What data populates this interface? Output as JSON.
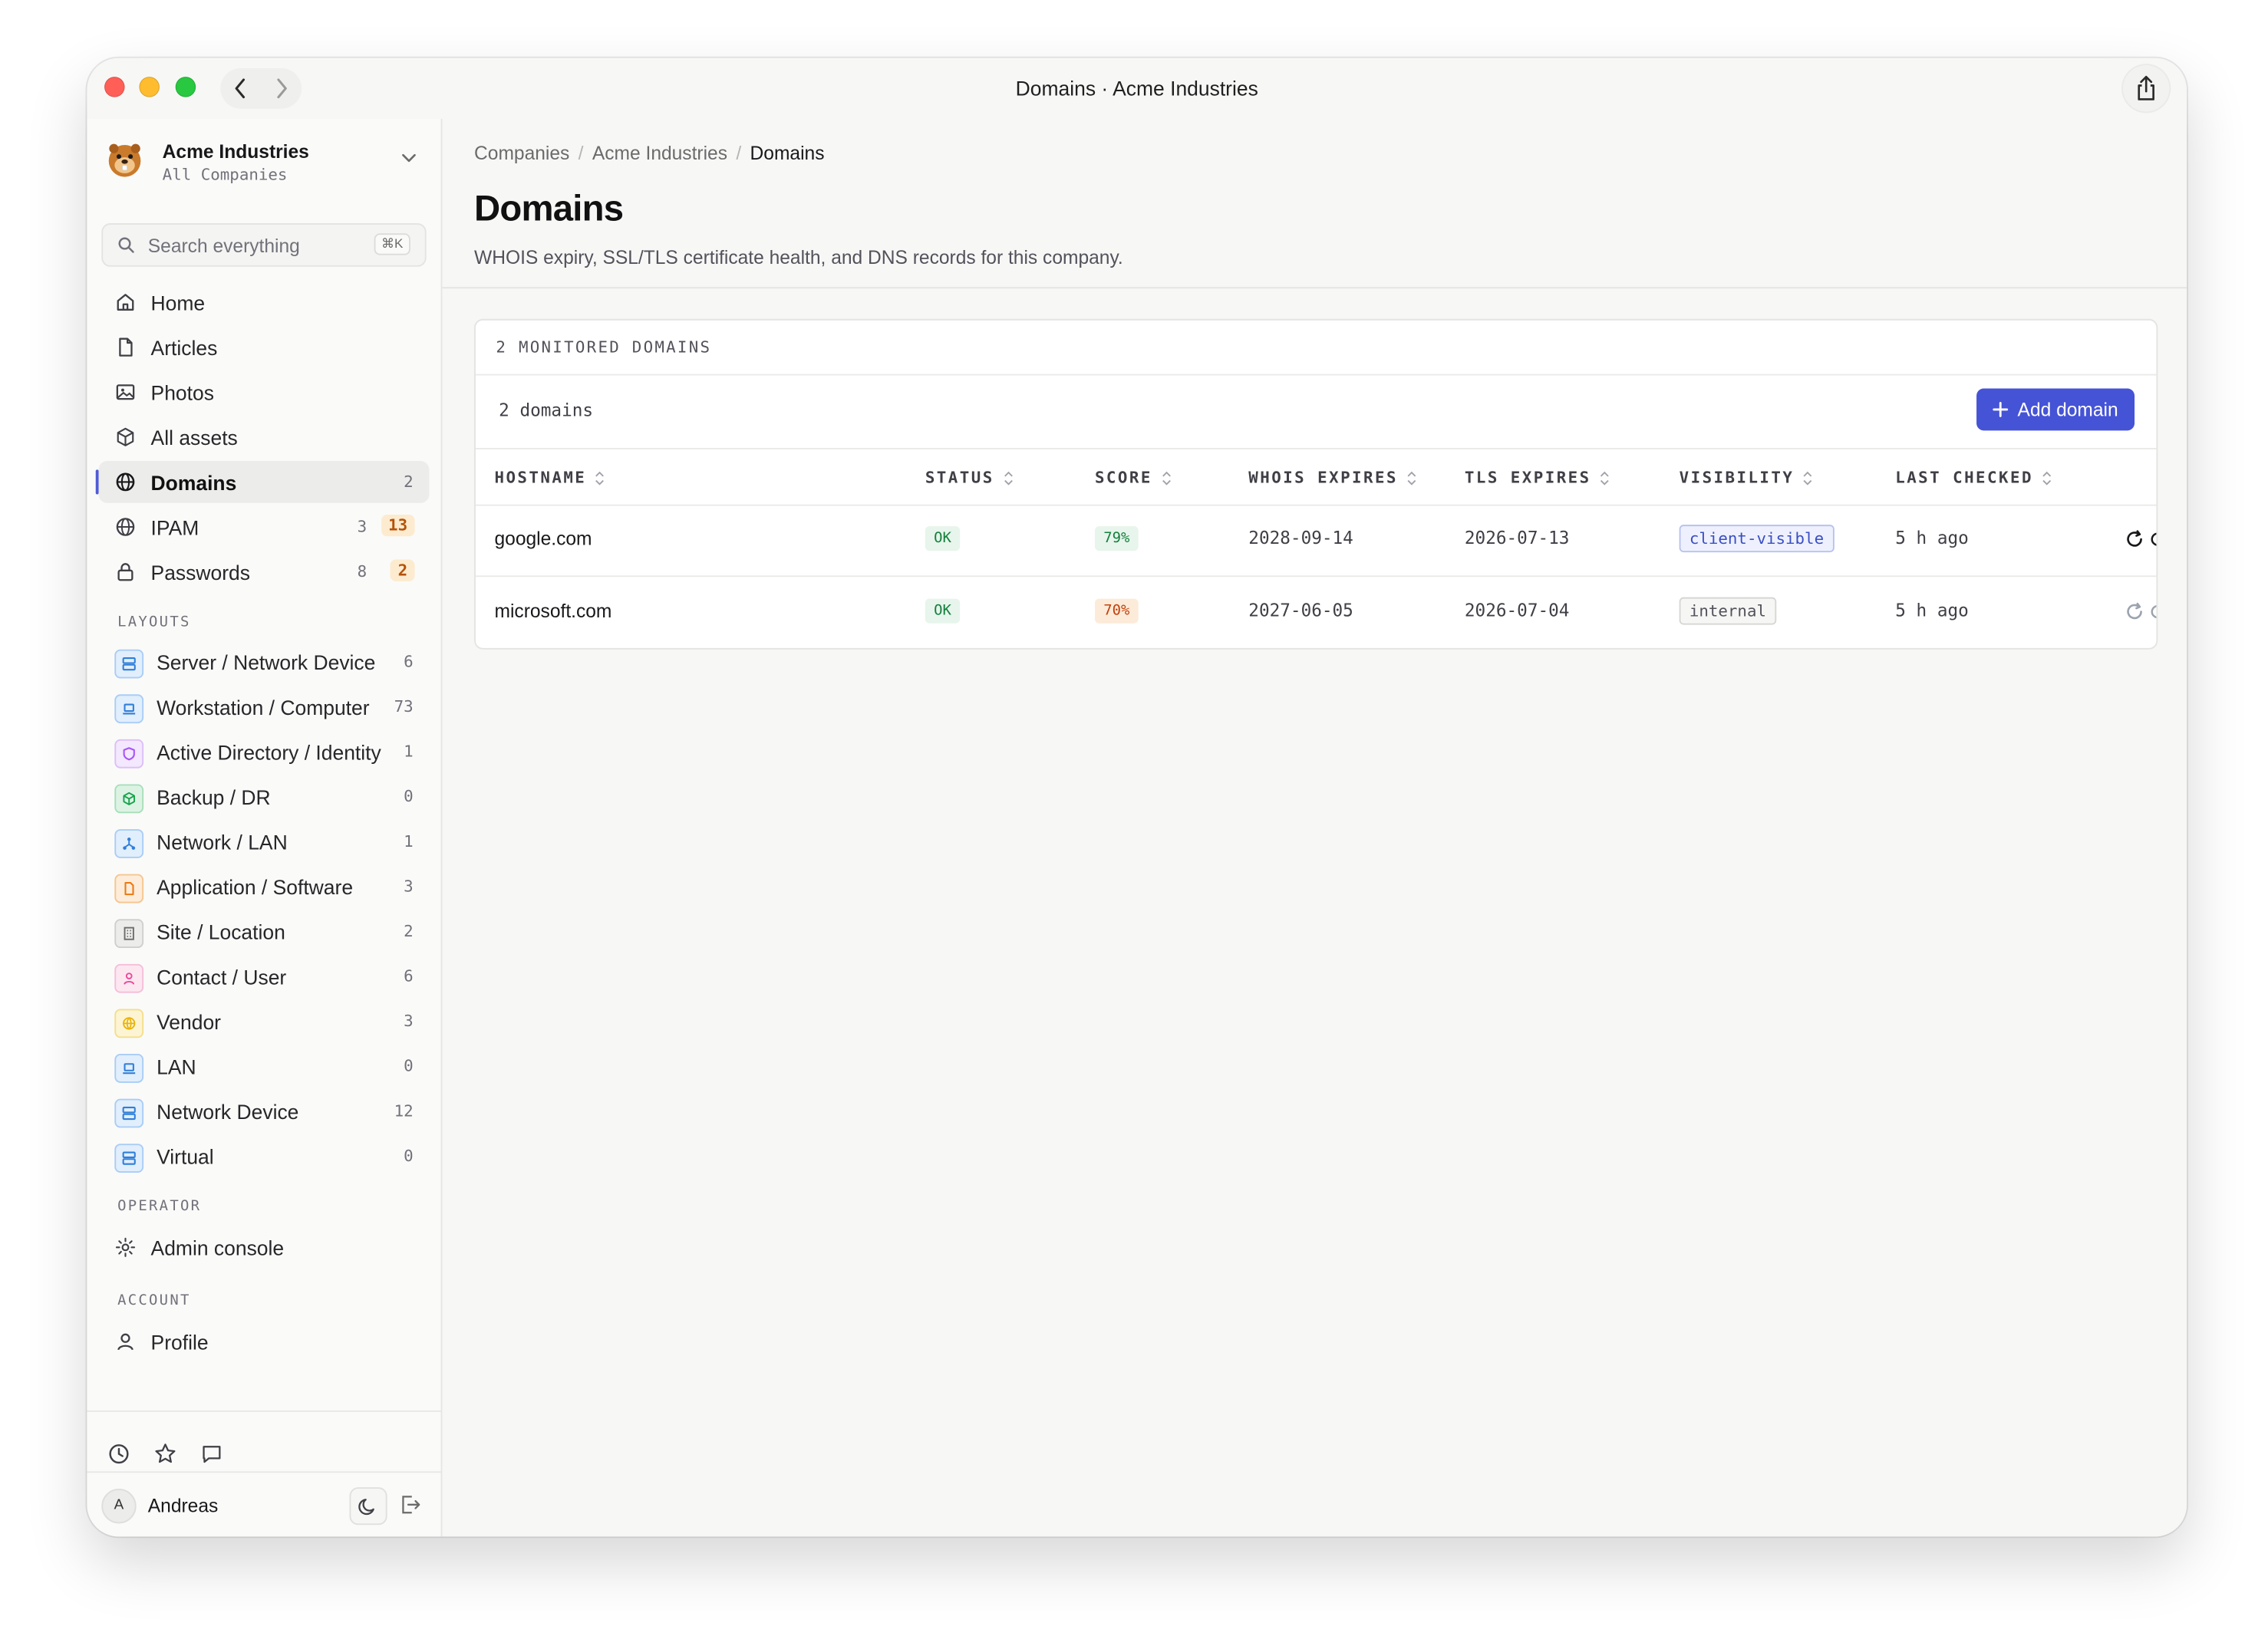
{
  "window": {
    "title": "Domains · Acme Industries"
  },
  "sidebar": {
    "company": {
      "name": "Acme Industries",
      "subtitle": "All Companies"
    },
    "search": {
      "placeholder": "Search everything",
      "shortcut": "⌘K"
    },
    "nav": [
      {
        "label": "Home",
        "icon": "home-icon"
      },
      {
        "label": "Articles",
        "icon": "file-icon"
      },
      {
        "label": "Photos",
        "icon": "image-icon"
      },
      {
        "label": "All assets",
        "icon": "box-icon"
      },
      {
        "label": "Domains",
        "icon": "globe-icon",
        "count": "2",
        "active": true
      },
      {
        "label": "IPAM",
        "icon": "globe-icon",
        "count": "3",
        "badge": "13"
      },
      {
        "label": "Passwords",
        "icon": "lock-icon",
        "count": "8",
        "badge": "2"
      }
    ],
    "layouts_label": "LAYOUTS",
    "layouts": [
      {
        "label": "Server / Network Device",
        "count": "6",
        "icon": "server-icon",
        "color": "#2f7fd8",
        "bg": "#e1eefc"
      },
      {
        "label": "Workstation / Computer",
        "count": "73",
        "icon": "laptop-icon",
        "color": "#2f7fd8",
        "bg": "#e1eefc"
      },
      {
        "label": "Active Directory / Identity",
        "count": "1",
        "icon": "shield-icon",
        "color": "#a855f7",
        "bg": "#f3e8fd"
      },
      {
        "label": "Backup / DR",
        "count": "0",
        "icon": "cube-icon",
        "color": "#16a34a",
        "bg": "#dcf3e4"
      },
      {
        "label": "Network / LAN",
        "count": "1",
        "icon": "network-icon",
        "color": "#2f7fd8",
        "bg": "#e1eefc"
      },
      {
        "label": "Application / Software",
        "count": "3",
        "icon": "document-icon",
        "color": "#ea7a14",
        "bg": "#fdecd9"
      },
      {
        "label": "Site / Location",
        "count": "2",
        "icon": "building-icon",
        "color": "#6b6b6b",
        "bg": "#ececea"
      },
      {
        "label": "Contact / User",
        "count": "6",
        "icon": "user-icon",
        "color": "#ec4899",
        "bg": "#fce7f1"
      },
      {
        "label": "Vendor",
        "count": "3",
        "icon": "globe-icon",
        "color": "#eab308",
        "bg": "#fdf4d3"
      },
      {
        "label": "LAN",
        "count": "0",
        "icon": "laptop-icon",
        "color": "#2f7fd8",
        "bg": "#e1eefc"
      },
      {
        "label": "Network Device",
        "count": "12",
        "icon": "server-icon",
        "color": "#2f7fd8",
        "bg": "#e1eefc"
      },
      {
        "label": "Virtual",
        "count": "0",
        "icon": "server-icon",
        "color": "#2f7fd8",
        "bg": "#e1eefc"
      }
    ],
    "operator_label": "OPERATOR",
    "operator_items": [
      {
        "label": "Admin console",
        "icon": "gear-icon"
      }
    ],
    "account_label": "ACCOUNT",
    "account_items": [
      {
        "label": "Profile",
        "icon": "user-icon"
      }
    ],
    "user": {
      "initial": "A",
      "name": "Andreas"
    }
  },
  "main": {
    "breadcrumb": [
      "Companies",
      "Acme Industries",
      "Domains"
    ],
    "title": "Domains",
    "subtitle": "WHOIS expiry, SSL/TLS certificate health, and DNS records for this company.",
    "card_header": "2 MONITORED DOMAINS",
    "domain_count": "2 domains",
    "add_button": "Add domain",
    "columns": [
      "HOSTNAME",
      "STATUS",
      "SCORE",
      "WHOIS EXPIRES",
      "TLS EXPIRES",
      "VISIBILITY",
      "LAST CHECKED"
    ],
    "rows": [
      {
        "hostname": "google.com",
        "status": "OK",
        "score": "79%",
        "score_color": "#15803d",
        "score_bg": "#e7f5ec",
        "whois": "2028-09-14",
        "tls": "2026-07-13",
        "visibility": "client-visible",
        "visibility_kind": "client",
        "last_checked": "5 h ago"
      },
      {
        "hostname": "microsoft.com",
        "status": "OK",
        "score": "70%",
        "score_color": "#c2410c",
        "score_bg": "#fdebd9",
        "whois": "2027-06-05",
        "tls": "2026-07-04",
        "visibility": "internal",
        "visibility_kind": "internal",
        "last_checked": "5 h ago"
      }
    ]
  },
  "colors": {
    "accent": "#4553d6",
    "ok_green": "#15803d",
    "warn_orange": "#c2410c"
  }
}
